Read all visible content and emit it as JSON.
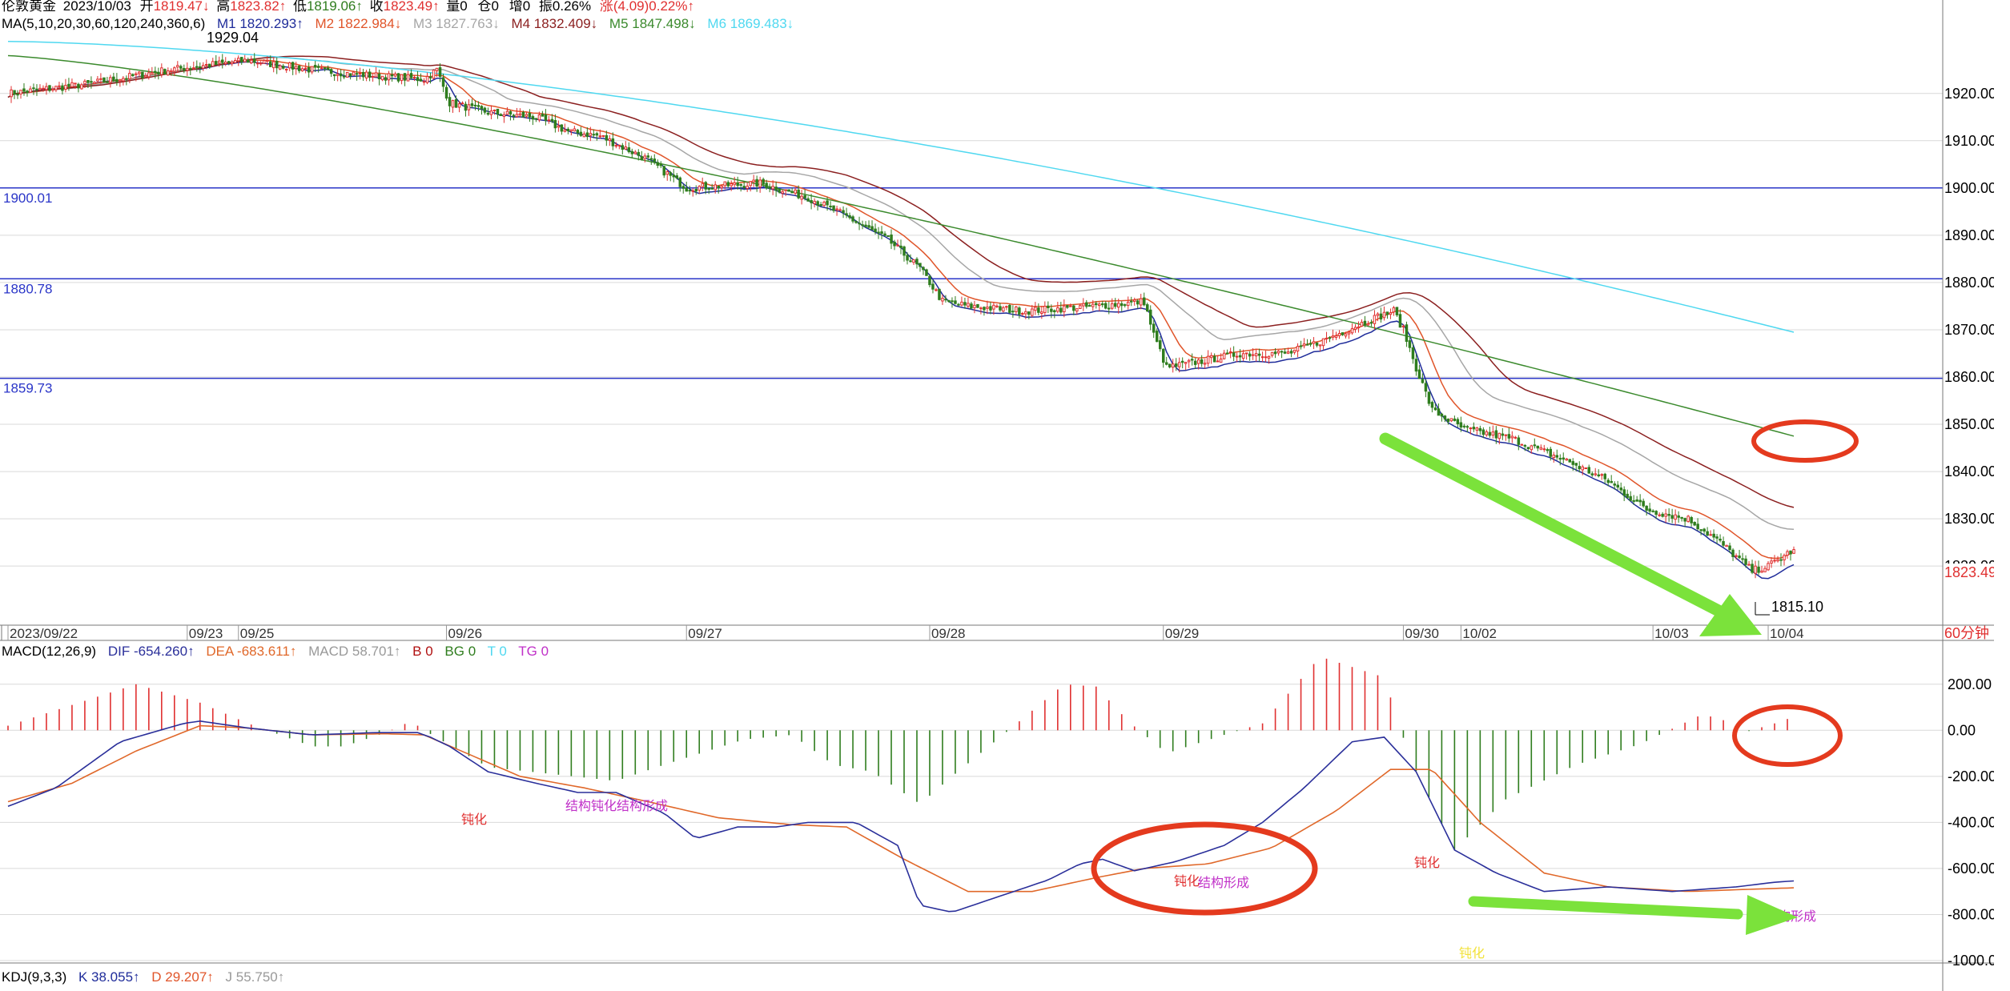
{
  "colors": {
    "up": "#e03030",
    "down": "#2f7d1e",
    "m1": "#1f2c9a",
    "m2": "#e0552a",
    "m3": "#a6a6a6",
    "m4": "#8b1f1f",
    "m5": "#3b8a2d",
    "m6": "#4fd8f0",
    "hline": "#2a35c8",
    "grid": "#d9d9d9",
    "dea": "#e0682a",
    "dif": "#2a2f9a",
    "annotRed": "#e43a1e",
    "annotGreen": "#7be23b",
    "purple": "#c030c8"
  },
  "header": {
    "name": "伦敦黄金",
    "date": "2023/10/03",
    "open_lbl": "开",
    "open_val": "1819.47↓",
    "high_lbl": "高",
    "high_val": "1823.82↑",
    "low_lbl": "低",
    "low_val": "1819.06↑",
    "close_lbl": "收",
    "close_val": "1823.49↑",
    "vol": "量0",
    "pos": "仓0",
    "inc": "增0",
    "amp": "振0.26%",
    "chg_lbl": "涨",
    "chg_val": "(4.09)0.22%↑"
  },
  "ma_line": {
    "label": "MA(5,10,20,30,60,120,240,360,6)",
    "m1": "M1 1820.293↑",
    "m2": "M2 1822.984↓",
    "m3": "M3 1827.763↓",
    "m4": "M4 1832.409↓",
    "m5": "M5 1847.498↓",
    "m6": "M6 1869.483↓"
  },
  "macd_line": {
    "label": "MACD(12,26,9)",
    "dif": "DIF -654.260↑",
    "dea": "DEA -683.611↑",
    "macd": "MACD 58.701↑",
    "b": "B 0",
    "bg": "BG 0",
    "t": "T 0",
    "tg": "TG 0"
  },
  "kdj_line": {
    "label": "KDJ(9,3,3)",
    "k": "K 38.055↑",
    "d": "D 29.207↑",
    "j": "J 55.750↑"
  },
  "price_labels": {
    "high_mark": "1929.04",
    "low_mark": "1815.10",
    "current": "1823.49",
    "period": "60分钟"
  },
  "hlines": [
    "1900.01",
    "1880.78",
    "1859.73"
  ],
  "dates": [
    "2023/09/22",
    "09/23",
    "09/25",
    "09/26",
    "09/27",
    "09/28",
    "09/29",
    "09/30",
    "10/02",
    "10/03",
    "10/04"
  ],
  "annotations": {
    "blunt": "钝化",
    "structure": "结构形成",
    "structure_partial": "构形成",
    "overlap": "结构钝化结构形成",
    "faint": "钝化"
  },
  "chart_data": [
    {
      "type": "candlestick",
      "title": "伦敦黄金 60分钟",
      "ylim": [
        1808,
        1933
      ],
      "y_ticks": [
        1820,
        1830,
        1840,
        1850,
        1860,
        1870,
        1880,
        1890,
        1900,
        1910,
        1920
      ],
      "x_labels": [
        "2023/09/22",
        "09/23",
        "09/25",
        "09/26",
        "09/27",
        "09/28",
        "09/29",
        "09/30",
        "10/02",
        "10/03",
        "10/04"
      ],
      "close_path": [
        [
          0,
          1920
        ],
        [
          25,
          1922
        ],
        [
          50,
          1925
        ],
        [
          75,
          1927
        ],
        [
          95,
          1925
        ],
        [
          110,
          1924
        ],
        [
          130,
          1923
        ],
        [
          134,
          1925
        ],
        [
          138,
          1918
        ],
        [
          150,
          1916
        ],
        [
          165,
          1915
        ],
        [
          175,
          1912
        ],
        [
          185,
          1911
        ],
        [
          200,
          1906
        ],
        [
          212,
          1900
        ],
        [
          235,
          1901
        ],
        [
          250,
          1898
        ],
        [
          262,
          1894
        ],
        [
          275,
          1889
        ],
        [
          285,
          1883
        ],
        [
          292,
          1876
        ],
        [
          300,
          1875
        ],
        [
          318,
          1874
        ],
        [
          340,
          1875
        ],
        [
          355,
          1876
        ],
        [
          358,
          1869
        ],
        [
          362,
          1862
        ],
        [
          370,
          1863
        ],
        [
          385,
          1865
        ],
        [
          400,
          1865
        ],
        [
          412,
          1868
        ],
        [
          425,
          1872
        ],
        [
          433,
          1874
        ],
        [
          436,
          1870
        ],
        [
          440,
          1862
        ],
        [
          445,
          1853
        ],
        [
          455,
          1849
        ],
        [
          470,
          1847
        ],
        [
          488,
          1842
        ],
        [
          500,
          1838
        ],
        [
          512,
          1832
        ],
        [
          525,
          1830
        ],
        [
          535,
          1825
        ],
        [
          545,
          1819
        ],
        [
          550,
          1820
        ],
        [
          558,
          1823.5
        ]
      ],
      "ma_series": [
        {
          "name": "M1",
          "end": 1820.293
        },
        {
          "name": "M2",
          "end": 1822.984
        },
        {
          "name": "M3",
          "end": 1827.763
        },
        {
          "name": "M4",
          "end": 1832.409
        },
        {
          "name": "M5",
          "end": 1847.498
        },
        {
          "name": "M6",
          "end": 1869.483
        }
      ],
      "reference_lines": [
        1900.01,
        1880.78,
        1859.73
      ],
      "high_point": 1929.04,
      "low_point": 1815.1,
      "last": 1823.49
    },
    {
      "type": "bar",
      "title": "MACD(12,26,9)",
      "ylim": [
        -1000,
        300
      ],
      "y_ticks": [
        200,
        0,
        -200,
        -400,
        -600,
        -800,
        -1000
      ],
      "dif_path": [
        [
          0,
          -330
        ],
        [
          15,
          -250
        ],
        [
          35,
          -50
        ],
        [
          55,
          30
        ],
        [
          60,
          40
        ],
        [
          75,
          10
        ],
        [
          95,
          -20
        ],
        [
          115,
          -10
        ],
        [
          128,
          -10
        ],
        [
          132,
          -30
        ],
        [
          138,
          -70
        ],
        [
          150,
          -180
        ],
        [
          165,
          -230
        ],
        [
          178,
          -270
        ],
        [
          190,
          -270
        ],
        [
          205,
          -360
        ],
        [
          215,
          -470
        ],
        [
          228,
          -420
        ],
        [
          240,
          -420
        ],
        [
          250,
          -400
        ],
        [
          265,
          -400
        ],
        [
          278,
          -500
        ],
        [
          285,
          -760
        ],
        [
          295,
          -790
        ],
        [
          310,
          -720
        ],
        [
          325,
          -650
        ],
        [
          335,
          -580
        ],
        [
          342,
          -560
        ],
        [
          352,
          -610
        ],
        [
          365,
          -570
        ],
        [
          380,
          -500
        ],
        [
          392,
          -400
        ],
        [
          405,
          -250
        ],
        [
          420,
          -50
        ],
        [
          430,
          -30
        ],
        [
          440,
          -180
        ],
        [
          452,
          -520
        ],
        [
          465,
          -620
        ],
        [
          480,
          -700
        ],
        [
          500,
          -680
        ],
        [
          520,
          -700
        ],
        [
          540,
          -680
        ],
        [
          552,
          -660
        ],
        [
          558,
          -654
        ]
      ],
      "dea_path": [
        [
          0,
          -310
        ],
        [
          20,
          -230
        ],
        [
          40,
          -90
        ],
        [
          60,
          20
        ],
        [
          75,
          10
        ],
        [
          95,
          -20
        ],
        [
          118,
          -15
        ],
        [
          130,
          -20
        ],
        [
          140,
          -80
        ],
        [
          160,
          -200
        ],
        [
          180,
          -250
        ],
        [
          200,
          -310
        ],
        [
          222,
          -380
        ],
        [
          245,
          -410
        ],
        [
          262,
          -420
        ],
        [
          280,
          -560
        ],
        [
          300,
          -700
        ],
        [
          320,
          -700
        ],
        [
          340,
          -640
        ],
        [
          355,
          -600
        ],
        [
          375,
          -580
        ],
        [
          395,
          -510
        ],
        [
          415,
          -350
        ],
        [
          432,
          -170
        ],
        [
          445,
          -170
        ],
        [
          460,
          -400
        ],
        [
          480,
          -620
        ],
        [
          500,
          -680
        ],
        [
          525,
          -700
        ],
        [
          545,
          -690
        ],
        [
          558,
          -684
        ]
      ],
      "hist_profile": [
        [
          0,
          20
        ],
        [
          40,
          200
        ],
        [
          60,
          120
        ],
        [
          75,
          30
        ],
        [
          95,
          -70
        ],
        [
          105,
          -70
        ],
        [
          118,
          -10
        ],
        [
          126,
          40
        ],
        [
          130,
          0
        ],
        [
          150,
          -160
        ],
        [
          190,
          -220
        ],
        [
          205,
          -150
        ],
        [
          230,
          -40
        ],
        [
          245,
          -20
        ],
        [
          258,
          -150
        ],
        [
          270,
          -180
        ],
        [
          285,
          -320
        ],
        [
          295,
          -200
        ],
        [
          310,
          -30
        ],
        [
          330,
          200
        ],
        [
          340,
          190
        ],
        [
          350,
          40
        ],
        [
          362,
          -100
        ],
        [
          380,
          -20
        ],
        [
          392,
          30
        ],
        [
          410,
          320
        ],
        [
          430,
          230
        ],
        [
          438,
          -120
        ],
        [
          452,
          -520
        ],
        [
          468,
          -300
        ],
        [
          490,
          -150
        ],
        [
          510,
          -60
        ],
        [
          528,
          60
        ],
        [
          535,
          60
        ],
        [
          540,
          -20
        ],
        [
          552,
          30
        ],
        [
          558,
          58.7
        ]
      ]
    }
  ]
}
